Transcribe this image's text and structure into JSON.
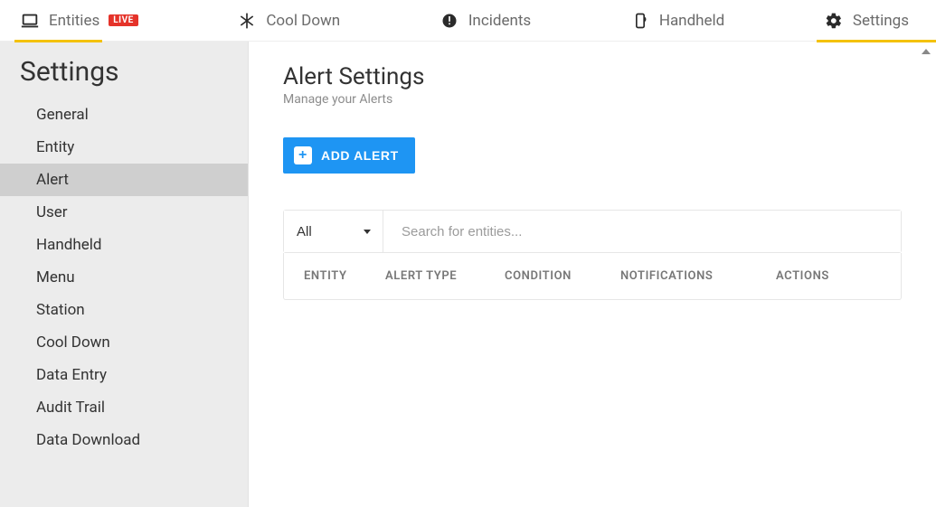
{
  "topnav": {
    "entities": {
      "label": "Entities",
      "badge": "LIVE"
    },
    "cooldown": {
      "label": "Cool Down"
    },
    "incidents": {
      "label": "Incidents"
    },
    "handheld": {
      "label": "Handheld"
    },
    "settings": {
      "label": "Settings"
    }
  },
  "sidebar": {
    "title": "Settings",
    "items": [
      {
        "label": "General"
      },
      {
        "label": "Entity"
      },
      {
        "label": "Alert",
        "active": true
      },
      {
        "label": "User"
      },
      {
        "label": "Handheld"
      },
      {
        "label": "Menu"
      },
      {
        "label": "Station"
      },
      {
        "label": "Cool Down"
      },
      {
        "label": "Data Entry"
      },
      {
        "label": "Audit Trail"
      },
      {
        "label": "Data Download"
      }
    ]
  },
  "main": {
    "title": "Alert Settings",
    "subtitle": "Manage your Alerts",
    "add_button": "ADD ALERT",
    "filter": {
      "selected": "All",
      "search_placeholder": "Search for entities..."
    },
    "columns": {
      "entity": "ENTITY",
      "alert_type": "ALERT TYPE",
      "condition": "CONDITION",
      "notifications": "NOTIFICATIONS",
      "actions": "ACTIONS"
    }
  }
}
